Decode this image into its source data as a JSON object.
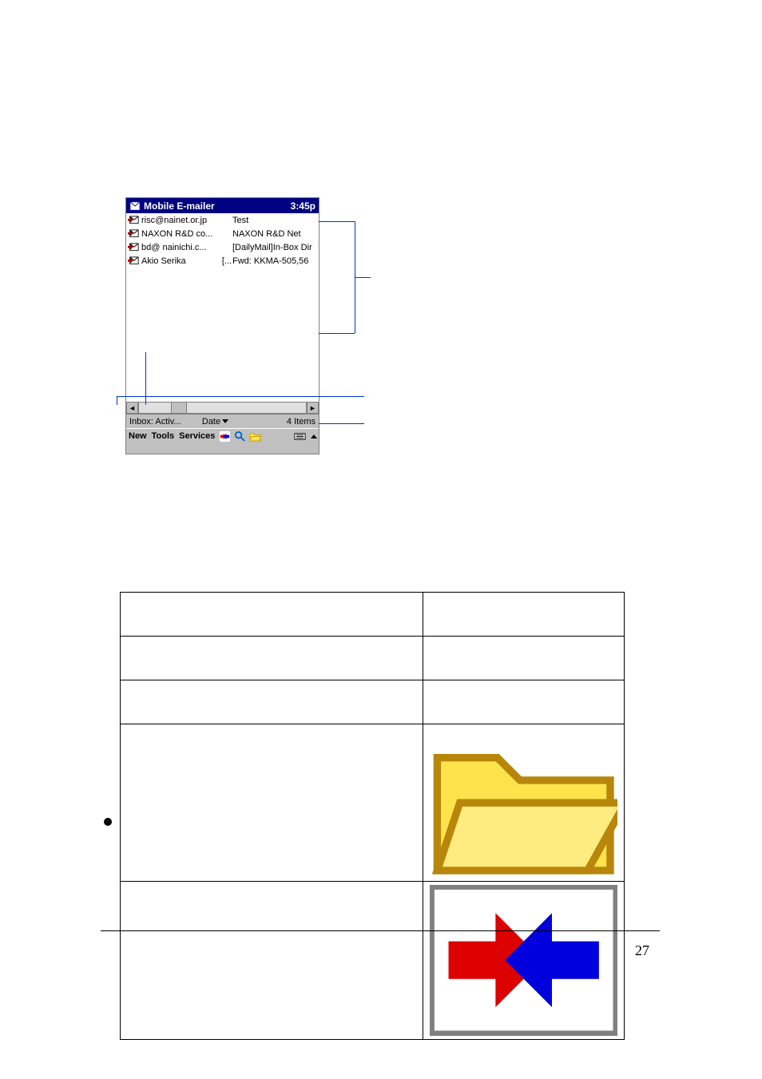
{
  "titlebar": {
    "app_name": "Mobile E-mailer",
    "clock": "3:45p",
    "icon": "app-icon"
  },
  "messages": [
    {
      "from": "risc@nainet.or.jp",
      "subject": "Test",
      "attachment": ""
    },
    {
      "from": "NAXON R&D co...",
      "subject": "NAXON R&D Net",
      "attachment": ""
    },
    {
      "from": "bd@ nainichi.c...",
      "subject": "[DailyMail]In-Box Dir",
      "attachment": ""
    },
    {
      "from": "Akio Serika",
      "subject": "Fwd: KKMA-505,56",
      "attachment": "[..."
    }
  ],
  "scrollbar": {
    "left_arrow": "◄",
    "right_arrow": "►"
  },
  "status": {
    "folder": "Inbox: Activ...",
    "sort": "Date",
    "count": "4 Items"
  },
  "menubar": {
    "items": [
      "New",
      "Tools",
      "Services"
    ],
    "icons": [
      "send-receive-icon",
      "search-icon",
      "open-folder-icon",
      "keyboard-icon"
    ]
  },
  "footer_page": "27",
  "table": {
    "rows": [
      {
        "label": "",
        "value": ""
      },
      {
        "label": "",
        "value": ""
      },
      {
        "label": "",
        "value": ""
      },
      {
        "label": "",
        "icon": "open-folder-icon"
      },
      {
        "label": "",
        "icon": "send-receive-icon"
      }
    ]
  }
}
